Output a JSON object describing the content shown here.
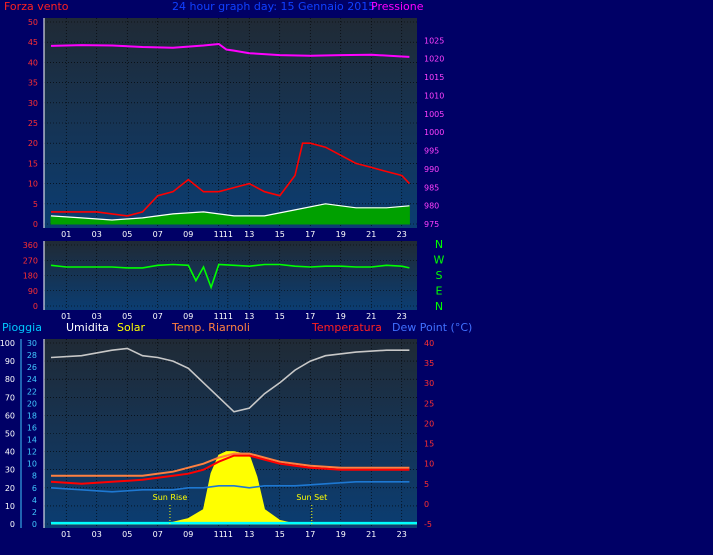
{
  "header": {
    "left": "Forza vento",
    "center": "24 hour graph day: 15 Gennaio 2015",
    "right": "Pressione"
  },
  "labels": {
    "pioggia": "Pioggia",
    "umidita": "Umidita",
    "solar": "Solar",
    "temp_riarnoli": "Temp. Riarnoli",
    "temperatura": "Temperatura",
    "dewpoint": "Dew Point (°C)",
    "sun_rise": "Sun Rise",
    "sun_set": "Sun Set"
  },
  "compass": [
    "N",
    "W",
    "S",
    "E",
    "N"
  ],
  "colors": {
    "background": "#000066",
    "plot_top": "#202a35",
    "plot_bottom": "#0b3d72",
    "wind": "#ff0000",
    "gust_avg": "#ffffff",
    "wind_low": "#00a000",
    "pressure": "#ff00ff",
    "direction": "#00ff00",
    "humidity": "#c8c8c8",
    "solar": "#ffff00",
    "temp_riarnoli": "#ff8040",
    "temperature": "#ff0000",
    "dewpoint": "#1e78d2",
    "rain": "#00ffff"
  },
  "chart_data": [
    {
      "type": "line",
      "x_tick_labels": [
        "01",
        "03",
        "05",
        "07",
        "09",
        "11",
        "11",
        "13",
        "15",
        "17",
        "19",
        "21",
        "23"
      ],
      "y_left": {
        "range": [
          0,
          50
        ],
        "ticks": [
          "0",
          "5",
          "10",
          "15",
          "20",
          "25",
          "30",
          "35",
          "40",
          "45",
          "50"
        ]
      },
      "y_right": {
        "range": [
          975,
          1030
        ],
        "ticks": [
          "975",
          "980",
          "985",
          "990",
          "995",
          "1000",
          "1005",
          "1010",
          "1015",
          "1020",
          "1025"
        ]
      },
      "series": [
        {
          "name": "Forza vento",
          "axis": "left",
          "x": [
            0,
            2,
            3,
            4,
            5,
            6,
            7,
            8,
            9,
            10,
            11,
            12,
            13,
            14,
            15,
            16,
            16.5,
            17,
            18,
            19,
            20,
            21,
            22,
            23,
            23.5
          ],
          "y": [
            3,
            3,
            3,
            2.5,
            2,
            3,
            7,
            8,
            11,
            8,
            8,
            9,
            10,
            8,
            7,
            12,
            20,
            20,
            19,
            17,
            15,
            14,
            13,
            12,
            10
          ]
        },
        {
          "axis": "left",
          "x": [
            0,
            2,
            4,
            6,
            8,
            10,
            12,
            14,
            16,
            18,
            20,
            22,
            23.5
          ],
          "y": [
            2,
            1.5,
            1,
            1.5,
            2.5,
            3,
            2,
            2,
            3.5,
            5,
            4,
            4,
            4.5
          ]
        },
        {
          "name": "Pressione",
          "axis": "right",
          "x": [
            0,
            2,
            4,
            6,
            8,
            10,
            11,
            11.5,
            12,
            13,
            15,
            17,
            19,
            21,
            23,
            23.5
          ],
          "y": [
            1023.5,
            1023.7,
            1023.6,
            1023.2,
            1023,
            1023.6,
            1024,
            1022.5,
            1022.2,
            1021.5,
            1021,
            1020.8,
            1021,
            1021.1,
            1020.6,
            1020.5
          ]
        }
      ]
    },
    {
      "type": "line",
      "x_tick_labels": [
        "01",
        "03",
        "05",
        "07",
        "09",
        "11",
        "11",
        "13",
        "15",
        "17",
        "19",
        "21",
        "23"
      ],
      "y_left": {
        "range": [
          0,
          360
        ],
        "ticks": [
          "0",
          "90",
          "180",
          "270",
          "360"
        ]
      },
      "series": [
        {
          "name": "Wind direction",
          "x": [
            0,
            1,
            2,
            3,
            4,
            5,
            6,
            7,
            8,
            9,
            9.5,
            10,
            10.5,
            11,
            12,
            13,
            14,
            15,
            16,
            17,
            18,
            19,
            20,
            21,
            22,
            23,
            23.5
          ],
          "y": [
            240,
            230,
            230,
            230,
            230,
            225,
            225,
            240,
            245,
            240,
            150,
            230,
            110,
            245,
            240,
            235,
            245,
            245,
            235,
            230,
            235,
            235,
            230,
            230,
            240,
            235,
            225
          ]
        }
      ]
    },
    {
      "type": "line",
      "x_tick_labels": [
        "01",
        "03",
        "05",
        "07",
        "09",
        "11",
        "11",
        "13",
        "15",
        "17",
        "19",
        "21",
        "23"
      ],
      "y_left": {
        "range": [
          0,
          100
        ],
        "ticks": [
          "0",
          "10",
          "20",
          "30",
          "40",
          "50",
          "60",
          "70",
          "80",
          "90",
          "100"
        ]
      },
      "y_left_inner": {
        "range": [
          0,
          30
        ],
        "ticks": [
          "0",
          "2",
          "4",
          "6",
          "8",
          "10",
          "12",
          "14",
          "16",
          "18",
          "20",
          "22",
          "24",
          "26",
          "28",
          "30"
        ]
      },
      "y_right": {
        "range": [
          -5,
          40
        ],
        "ticks": [
          "-5",
          "0",
          "5",
          "10",
          "15",
          "20",
          "25",
          "30",
          "35",
          "40"
        ]
      },
      "series": [
        {
          "name": "Umidita",
          "axis": "left",
          "x": [
            0,
            2,
            4,
            5,
            6,
            7,
            8,
            9,
            10,
            11,
            12,
            13,
            14,
            15,
            16,
            17,
            18,
            20,
            22,
            23.5
          ],
          "y": [
            92,
            93,
            96,
            97,
            93,
            92,
            90,
            86,
            78,
            70,
            62,
            64,
            72,
            78,
            85,
            90,
            93,
            95,
            96,
            96
          ]
        },
        {
          "name": "Solar",
          "axis": "left",
          "x": [
            0,
            7,
            8,
            9,
            10,
            10.5,
            11,
            11.5,
            12,
            12.5,
            13,
            13.5,
            14,
            15,
            16,
            24
          ],
          "y": [
            0,
            0,
            1,
            3,
            8,
            28,
            38,
            40,
            40,
            39,
            38,
            26,
            8,
            2,
            0,
            0
          ]
        },
        {
          "name": "Temp. Riarnoli",
          "axis": "right",
          "x": [
            0,
            2,
            4,
            6,
            8,
            9,
            10,
            11,
            12,
            13,
            14,
            15,
            16,
            17,
            19,
            21,
            23.5
          ],
          "y": [
            7,
            7,
            7,
            7,
            8,
            9,
            10,
            11.5,
            12.5,
            12.5,
            11.5,
            10.5,
            10,
            9.5,
            9,
            9,
            9
          ]
        },
        {
          "name": "Temperatura",
          "axis": "right",
          "x": [
            0,
            2,
            4,
            6,
            8,
            9,
            10,
            11,
            12,
            13,
            14,
            15,
            16,
            17,
            19,
            21,
            23.5
          ],
          "y": [
            5.5,
            5,
            5.5,
            6,
            7,
            7.5,
            8.5,
            10.5,
            12,
            12,
            11,
            10,
            9.5,
            9,
            8.5,
            8.5,
            8.5
          ]
        },
        {
          "name": "Dew Point (°C)",
          "axis": "right",
          "x": [
            0,
            2,
            4,
            6,
            8,
            9,
            10,
            11,
            12,
            13,
            14,
            16,
            18,
            20,
            22,
            23.5
          ],
          "y": [
            4,
            3.5,
            3,
            3.5,
            3.5,
            4,
            4,
            4.5,
            4.5,
            4,
            4.5,
            4.5,
            5,
            5.5,
            5.5,
            5.5
          ]
        },
        {
          "name": "Pioggia",
          "axis": "left",
          "x": [
            0,
            24
          ],
          "y": [
            0.5,
            0.5
          ]
        }
      ],
      "annotations": [
        {
          "text": "Sun Rise",
          "x": 7.8
        },
        {
          "text": "Sun Set",
          "x": 17.1
        }
      ]
    }
  ]
}
